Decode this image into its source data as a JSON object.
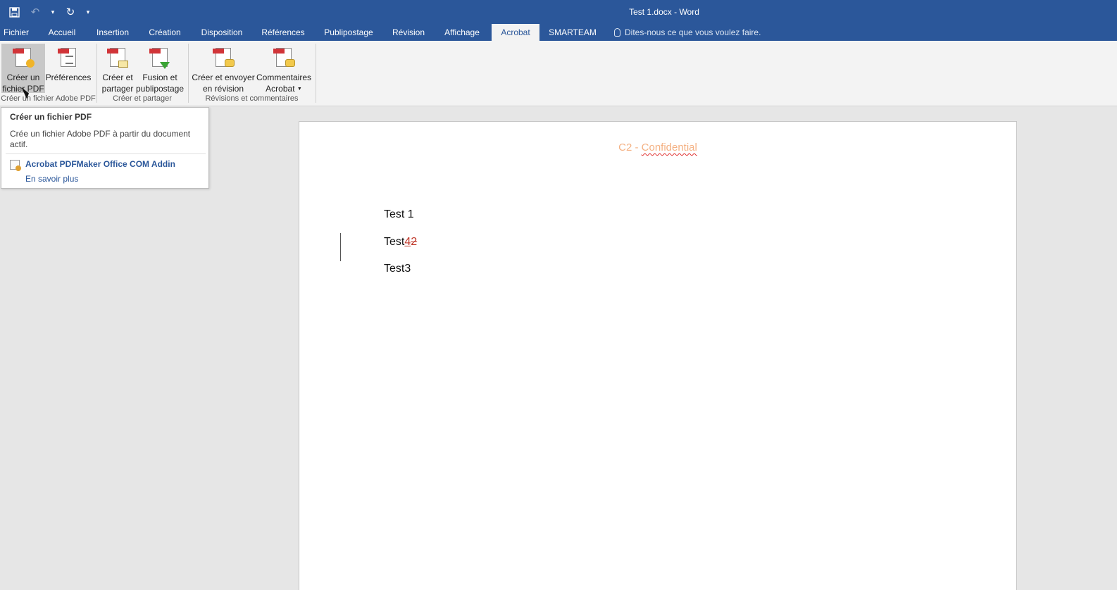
{
  "window": {
    "title": "Test 1.docx - Word"
  },
  "tabs": [
    {
      "label": "Fichier"
    },
    {
      "label": "Accueil"
    },
    {
      "label": "Insertion"
    },
    {
      "label": "Création"
    },
    {
      "label": "Disposition"
    },
    {
      "label": "Références"
    },
    {
      "label": "Publipostage"
    },
    {
      "label": "Révision"
    },
    {
      "label": "Affichage"
    },
    {
      "label": "Acrobat"
    },
    {
      "label": "SMARTEAM"
    }
  ],
  "active_tab": "Acrobat",
  "tellme": {
    "text": "Dites-nous ce que vous voulez faire."
  },
  "ribbon": {
    "buttons": [
      {
        "line1": "Créer un",
        "line2": "fichier PDF"
      },
      {
        "line1": "Préférences",
        "line2": ""
      },
      {
        "line1": "Créer et",
        "line2": "partager"
      },
      {
        "line1": "Fusion et",
        "line2": "publipostage"
      },
      {
        "line1": "Créer et envoyer",
        "line2": "en révision"
      },
      {
        "line1": "Commentaires",
        "line2": "Acrobat"
      }
    ],
    "groups": [
      {
        "label": "Créer un fichier Adobe PDF"
      },
      {
        "label": "Créer et partager"
      },
      {
        "label": "Révisions et commentaires"
      }
    ]
  },
  "tooltip": {
    "title": "Créer un fichier PDF",
    "description": "Crée un fichier Adobe PDF à partir du document actif.",
    "addin": "Acrobat PDFMaker Office COM Addin",
    "more": "En savoir plus"
  },
  "document": {
    "header_prefix": "C2 - ",
    "header_word": "Confidential",
    "paragraphs": {
      "p1": "Test 1",
      "p2_base": "Test",
      "p2_inserted": "4",
      "p2_deleted": "2",
      "p3": "Test3"
    }
  },
  "colors": {
    "titlebar": "#2b579a",
    "ribbon": "#f3f3f3",
    "header_text": "#f4b183",
    "revision": "#c0392b"
  }
}
